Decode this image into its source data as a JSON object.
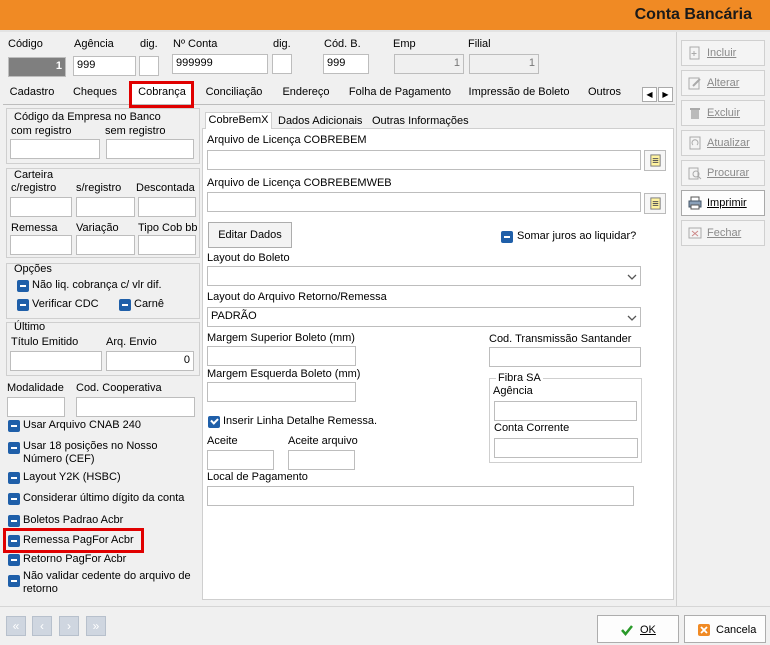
{
  "window": {
    "title": "Conta Bancária"
  },
  "header": {
    "codigo_label": "Código",
    "codigo_value": "1",
    "agencia_label": "Agência",
    "agencia_value": "999",
    "dig_label": "dig.",
    "dig1_value": "",
    "conta_label": "Nº Conta",
    "conta_value": "999999",
    "dig2_value": "",
    "codb_label": "Cód. B.",
    "codb_value": "999",
    "emp_label": "Emp",
    "emp_value": "1",
    "filial_label": "Filial",
    "filial_value": "1"
  },
  "side_buttons": [
    {
      "label": "Incluir",
      "icon": "plus-document-icon"
    },
    {
      "label": "Alterar",
      "icon": "pencil-icon"
    },
    {
      "label": "Excluir",
      "icon": "trash-icon"
    },
    {
      "label": "Atualizar",
      "icon": "refresh-icon"
    },
    {
      "label": "Procurar",
      "icon": "search-icon"
    },
    {
      "label": "Imprimir",
      "icon": "printer-icon"
    },
    {
      "label": "Fechar",
      "icon": "close-icon"
    }
  ],
  "tabs": [
    "Cadastro",
    "Cheques",
    "Cobrança",
    "Conciliação",
    "Endereço",
    "Folha de Pagamento",
    "Impressão de Boleto",
    "Outros"
  ],
  "active_tab": "Cobrança",
  "left": {
    "codigo_empresa_title": "Código da Empresa no Banco",
    "com_registro": "com registro",
    "sem_registro": "sem registro",
    "carteira_title": "Carteira",
    "c_registro": "c/registro",
    "s_registro": "s/registro",
    "descontada": "Descontada",
    "remessa": "Remessa",
    "variacao": "Variação",
    "tipo_cob": "Tipo Cob bb",
    "opcoes_title": "Opções",
    "opt_nao_liq": "Não liq. cobrança c/ vlr dif.",
    "opt_verificar_cdc": "Verificar CDC",
    "opt_carne": "Carnê",
    "ultimo_title": "Último",
    "titulo_emitido": "Título Emitido",
    "arq_envio": "Arq. Envio",
    "arq_envio_value": "0",
    "modalidade": "Modalidade",
    "cod_cooperativa": "Cod. Cooperativa",
    "chk_cnab240": "Usar Arquivo CNAB 240",
    "chk_18pos_1": "Usar 18 posições no Nosso",
    "chk_18pos_2": "Número (CEF)",
    "chk_y2k": "Layout Y2K (HSBC)",
    "chk_ultimo_digito": "Considerar último dígito da conta",
    "chk_boletos_acbr": "Boletos Padrao Acbr",
    "chk_remessa_pagfor": "Remessa PagFor Acbr",
    "chk_retorno_pagfor": "Retorno PagFor Acbr",
    "chk_nao_validar_1": "Não validar cedente do arquivo de",
    "chk_nao_validar_2": "retorno"
  },
  "subtabs": [
    "CobreBemX",
    "Dados Adicionais",
    "Outras Informações"
  ],
  "right": {
    "licenca_cobrebem": "Arquivo de Licença COBREBEM",
    "licenca_cobrebemweb": "Arquivo de Licença COBREBEMWEB",
    "editar_dados": "Editar Dados",
    "somar_juros": "Somar juros ao liquidar?",
    "layout_boleto": "Layout do Boleto",
    "layout_boleto_value": "",
    "layout_retorno": "Layout do Arquivo Retorno/Remessa",
    "layout_retorno_value": "PADRÃO",
    "margem_superior": "Margem Superior Boleto (mm)",
    "cod_transmissao": "Cod. Transmissão Santander",
    "margem_esquerda": "Margem Esquerda Boleto (mm)",
    "fibra_title": "Fibra SA",
    "fibra_agencia": "Agência",
    "fibra_conta": "Conta Corrente",
    "inserir_linha": "Inserir Linha Detalhe Remessa.",
    "aceite": "Aceite",
    "aceite_arquivo": "Aceite arquivo",
    "local_pagamento": "Local de Pagamento"
  },
  "footer": {
    "ok": "OK",
    "cancel": "Cancela"
  },
  "colors": {
    "title_bar": "#f08a24",
    "highlight": "#e00000",
    "checkbox": "#1f5fa9"
  }
}
